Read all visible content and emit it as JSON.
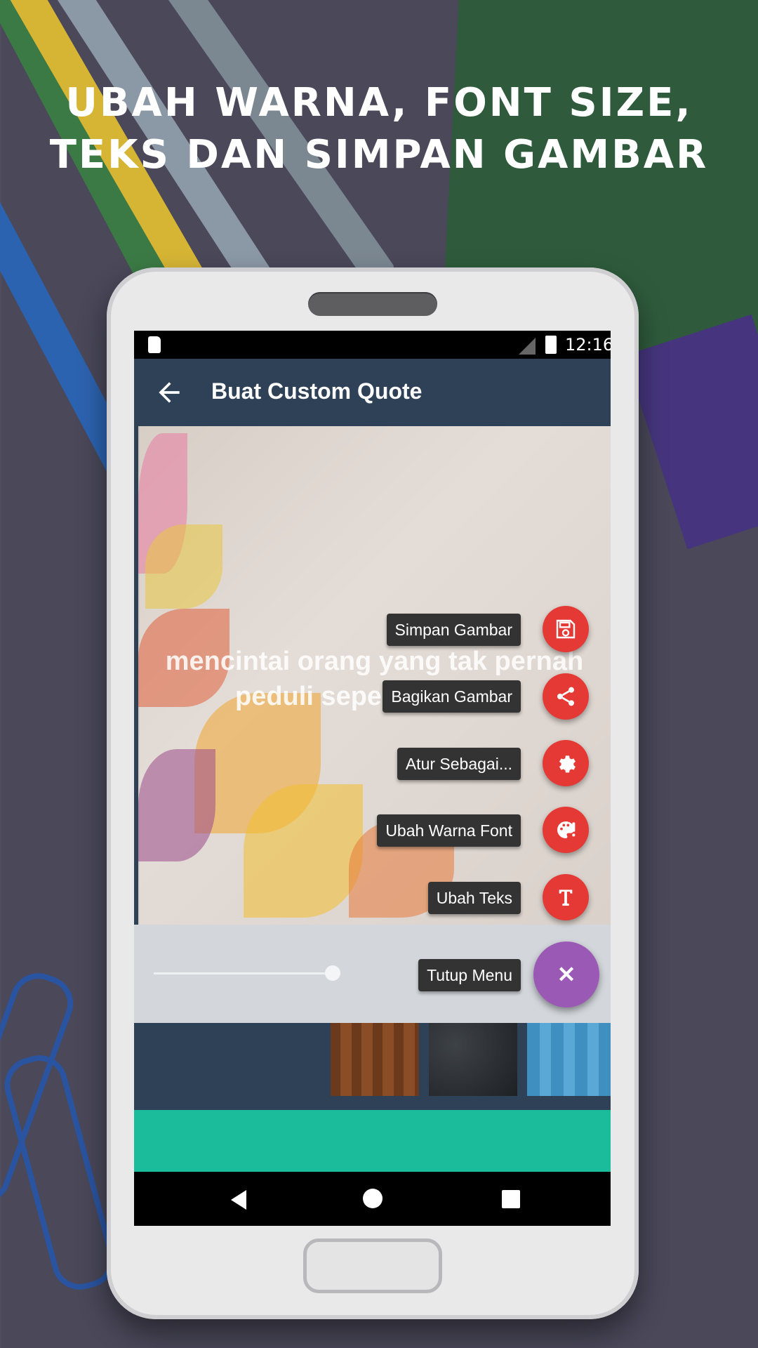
{
  "headline": {
    "line1": "UBAH WARNA, FONT SIZE,",
    "line2": "TEKS DAN SIMPAN GAMBAR"
  },
  "status_bar": {
    "time": "12:16",
    "icons": [
      "sd-card-icon",
      "no-signal-icon",
      "battery-charging-icon"
    ]
  },
  "app_bar": {
    "title": "Buat Custom Quote",
    "back_icon": "arrow-left-icon"
  },
  "canvas": {
    "quote_line1": "mencintai orang yang tak pernah",
    "quote_line2": "peduli sepe"
  },
  "fab_menu": {
    "items": [
      {
        "label": "Simpan Gambar",
        "icon": "save-icon"
      },
      {
        "label": "Bagikan Gambar",
        "icon": "share-icon"
      },
      {
        "label": "Atur Sebagai...",
        "icon": "gear-icon"
      },
      {
        "label": "Ubah Warna Font",
        "icon": "palette-icon"
      },
      {
        "label": "Ubah Teks",
        "icon": "text-icon"
      }
    ],
    "close": {
      "label": "Tutup Menu",
      "icon": "close-icon",
      "glyph": "✕"
    },
    "colors": {
      "item": "#e53935",
      "main": "#9b59b6",
      "label_bg": "#333333"
    }
  },
  "colors": {
    "app_bar": "#2f4157",
    "ad_bar": "#1abc9c"
  }
}
